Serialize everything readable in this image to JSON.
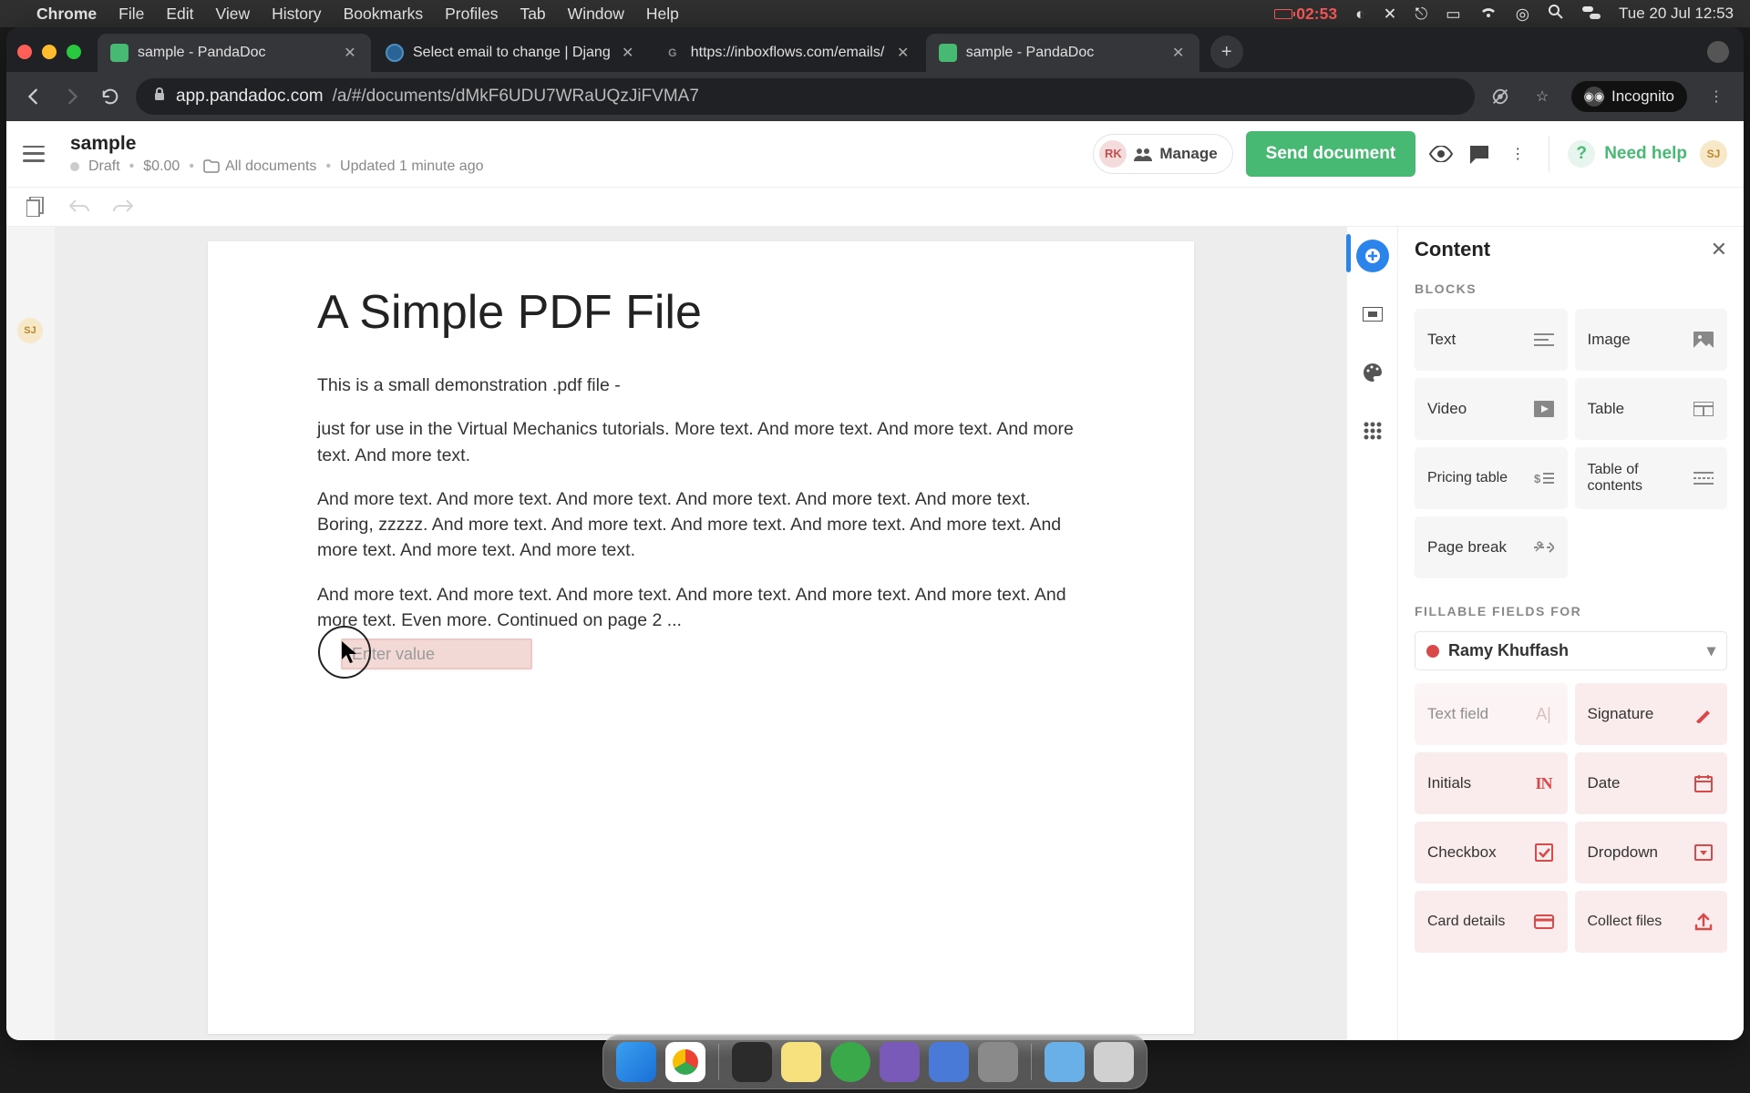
{
  "menubar": {
    "app": "Chrome",
    "items": [
      "File",
      "Edit",
      "View",
      "History",
      "Bookmarks",
      "Profiles",
      "Tab",
      "Window",
      "Help"
    ],
    "battery": "02:53",
    "date": "Tue 20 Jul  12:53"
  },
  "chrome": {
    "tabs": [
      {
        "title": "sample - PandaDoc",
        "favicon": "pd"
      },
      {
        "title": "Select email to change | Djang",
        "favicon": "dj"
      },
      {
        "title": "https://inboxflows.com/emails/",
        "favicon": "text"
      },
      {
        "title": "sample - PandaDoc",
        "favicon": "pd"
      }
    ],
    "url_domain": "app.pandadoc.com",
    "url_path": "/a/#/documents/dMkF6UDU7WRaUQzJiFVMA7",
    "incognito": "Incognito"
  },
  "header": {
    "title": "sample",
    "status": "Draft",
    "price": "$0.00",
    "folder": "All documents",
    "updated": "Updated 1 minute ago",
    "rk_initials": "RK",
    "manage": "Manage",
    "send": "Send document",
    "need_help": "Need help",
    "sj": "SJ"
  },
  "sidebar_user": "SJ",
  "doc": {
    "h1": "A Simple PDF File",
    "p1": "This is a small demonstration .pdf file -",
    "p2": "just for use in the Virtual Mechanics tutorials. More text. And more text. And more text. And more text. And more text.",
    "p3": "And more text. And more text. And more text. And more text. And more text. And more text. Boring, zzzzz. And more text. And more text. And more text. And more text. And more text. And more text. And more text. And more text.",
    "p4": "And more text. And more text. And more text. And more text. And more text. And more text. And more text. Even more. Continued on page 2 ...",
    "field_placeholder": "Enter value"
  },
  "panel": {
    "title": "Content",
    "blocks_label": "BLOCKS",
    "blocks": {
      "text": "Text",
      "image": "Image",
      "video": "Video",
      "table": "Table",
      "pricing": "Pricing table",
      "toc": "Table of contents",
      "pagebreak": "Page break"
    },
    "fields_label": "FILLABLE FIELDS FOR",
    "recipient": "Ramy Khuffash",
    "fields": {
      "textfield": "Text field",
      "signature": "Signature",
      "initials": "Initials",
      "date": "Date",
      "checkbox": "Checkbox",
      "dropdown": "Dropdown",
      "card": "Card details",
      "collect": "Collect files"
    }
  }
}
